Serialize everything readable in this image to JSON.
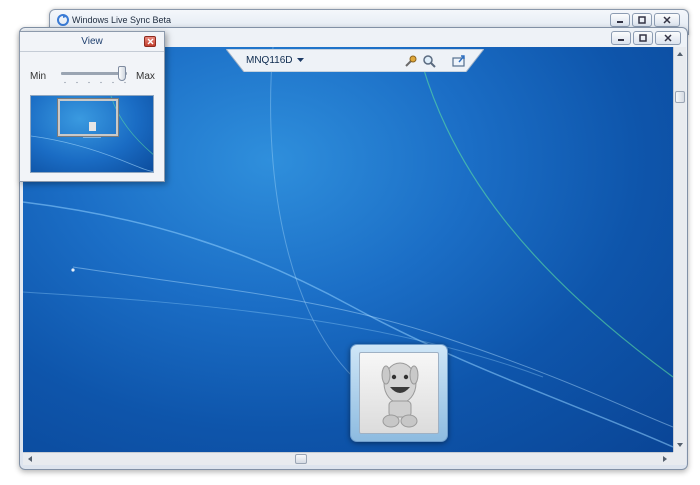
{
  "outer_window": {
    "title": "Windows Live Sync Beta"
  },
  "toolbar": {
    "machine_name": "MNQ116D",
    "icons": [
      "settings-tools-icon",
      "zoom-icon",
      "send-to-computer-icon"
    ]
  },
  "view_panel": {
    "title": "View",
    "zoom_min_label": "Min",
    "zoom_max_label": "Max",
    "zoom_level": 0.92
  },
  "scroll": {
    "vertical_position": 0.0,
    "horizontal_position": 0.45
  },
  "colors": {
    "desktop_blue": "#1b6ec6",
    "frame": "#dde4ee",
    "close_red": "#c43f2e"
  }
}
